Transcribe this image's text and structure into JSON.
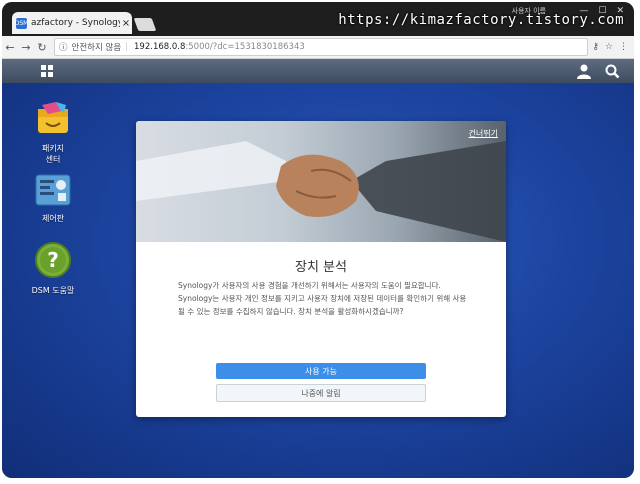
{
  "browser": {
    "tab_title": "azfactory - Synology Di",
    "tab_favicon": "DSM",
    "tab_close": "×",
    "security_label": "안전하지 않음",
    "url_host": "192.168.0.8",
    "url_rest": ":5000/?dc=1531830186343",
    "user_hint": "사용자 이름",
    "watermark": "https://kimazfactory.tistory.com"
  },
  "desktop": {
    "icons": [
      {
        "label_line1": "패키지",
        "label_line2": "센터",
        "icon": "package-center-icon"
      },
      {
        "label_line1": "제어판",
        "label_line2": "",
        "icon": "control-panel-icon"
      },
      {
        "label_line1": "DSM 도움말",
        "label_line2": "",
        "icon": "help-icon"
      }
    ]
  },
  "modal": {
    "skip": "건너뛰기",
    "title": "장치 분석",
    "body": "Synology가 사용자의 사용 경험을 개선하기 위해서는 사용자의 도움이 필요합니다. Synology는 사용자 개인 정보를 지키고 사용자 장치에 저장된 데이터를 확인하기 위해 사용될 수 있는 정보를 수집하지 않습니다. 장치 분석을 활성화하시겠습니까?",
    "enable_button": "사용 가능",
    "later_button": "나중에 알림"
  },
  "colors": {
    "accent": "#3d8ee8",
    "desktop": "#1c44a0"
  }
}
